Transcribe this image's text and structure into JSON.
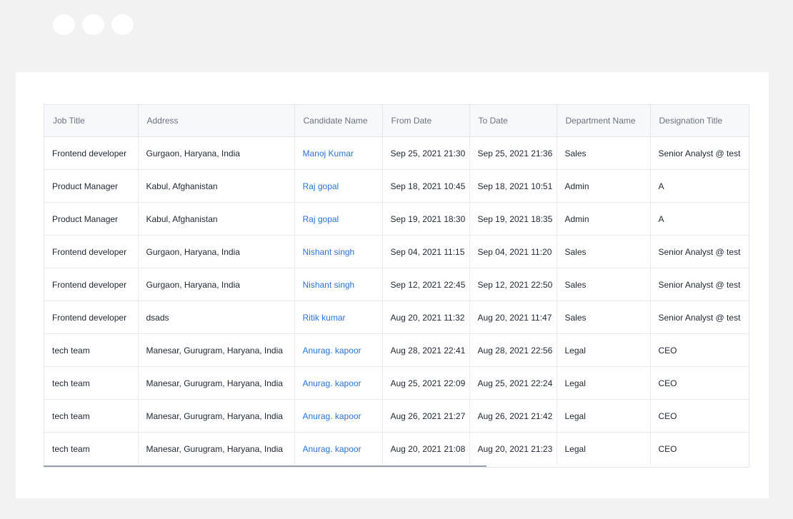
{
  "table": {
    "headers": [
      "Job Title",
      "Address",
      "Candidate Name",
      "From Date",
      "To Date",
      "Department Name",
      "Designation Title"
    ],
    "rows": [
      [
        "Frontend developer",
        "Gurgaon, Haryana, India",
        "Manoj Kumar",
        "Sep 25, 2021 21:30",
        "Sep 25, 2021 21:36",
        "Sales",
        "Senior Analyst @ test"
      ],
      [
        "Product Manager",
        "Kabul, Afghanistan",
        "Raj gopal",
        "Sep 18, 2021 10:45",
        "Sep 18, 2021 10:51",
        "Admin",
        "A"
      ],
      [
        "Product Manager",
        "Kabul, Afghanistan",
        "Raj gopal",
        "Sep 19, 2021 18:30",
        "Sep 19, 2021 18:35",
        "Admin",
        "A"
      ],
      [
        "Frontend developer",
        "Gurgaon, Haryana, India",
        "Nishant singh",
        "Sep 04, 2021 11:15",
        "Sep 04, 2021 11:20",
        "Sales",
        "Senior Analyst @ test"
      ],
      [
        "Frontend developer",
        "Gurgaon, Haryana, India",
        "Nishant singh",
        "Sep 12, 2021 22:45",
        "Sep 12, 2021 22:50",
        "Sales",
        "Senior Analyst @ test"
      ],
      [
        "Frontend developer",
        "dsads",
        "Ritik kumar",
        "Aug 20, 2021 11:32",
        "Aug 20, 2021 11:47",
        "Sales",
        "Senior Analyst @ test"
      ],
      [
        "tech team",
        "Manesar, Gurugram, Haryana, India",
        "Anurag. kapoor",
        "Aug 28, 2021 22:41",
        "Aug 28, 2021 22:56",
        "Legal",
        "CEO"
      ],
      [
        "tech team",
        "Manesar, Gurugram, Haryana, India",
        "Anurag. kapoor",
        "Aug 25, 2021 22:09",
        "Aug 25, 2021 22:24",
        "Legal",
        "CEO"
      ],
      [
        "tech team",
        "Manesar, Gurugram, Haryana, India",
        "Anurag. kapoor",
        "Aug 26, 2021 21:27",
        "Aug 26, 2021 21:42",
        "Legal",
        "CEO"
      ],
      [
        "tech team",
        "Manesar, Gurugram, Haryana, India",
        "Anurag. kapoor",
        "Aug 20, 2021 21:08",
        "Aug 20, 2021 21:23",
        "Legal",
        "CEO"
      ]
    ]
  },
  "colors": {
    "link": "#2774d8",
    "header_bg": "#f7f8fa",
    "page_bg": "#f2f2f2"
  }
}
